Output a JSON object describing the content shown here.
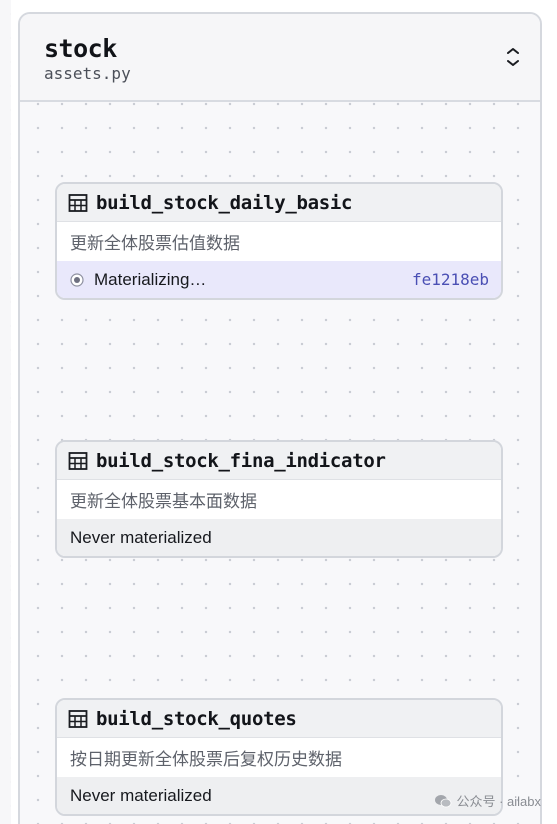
{
  "group": {
    "title": "stock",
    "subtitle": "assets.py"
  },
  "assets": [
    {
      "name": "build_stock_daily_basic",
      "description": "更新全体股票估值数据",
      "status": "Materializing…",
      "run_id": "fe1218eb"
    },
    {
      "name": "build_stock_fina_indicator",
      "description": "更新全体股票基本面数据",
      "status": "Never materialized"
    },
    {
      "name": "build_stock_quotes",
      "description": "按日期更新全体股票后复权历史数据",
      "status": "Never materialized"
    }
  ],
  "watermark": "公众号 · ailabx",
  "icons": {
    "asset": "table-icon",
    "collapse": "chevron-up-down-icon",
    "status_running": "radio-dot-icon",
    "watermark": "wechat-icon"
  },
  "colors": {
    "materializing_bg": "#e9e8fb",
    "run_id": "#4a4fb4",
    "never_bg": "#eeeff1"
  }
}
